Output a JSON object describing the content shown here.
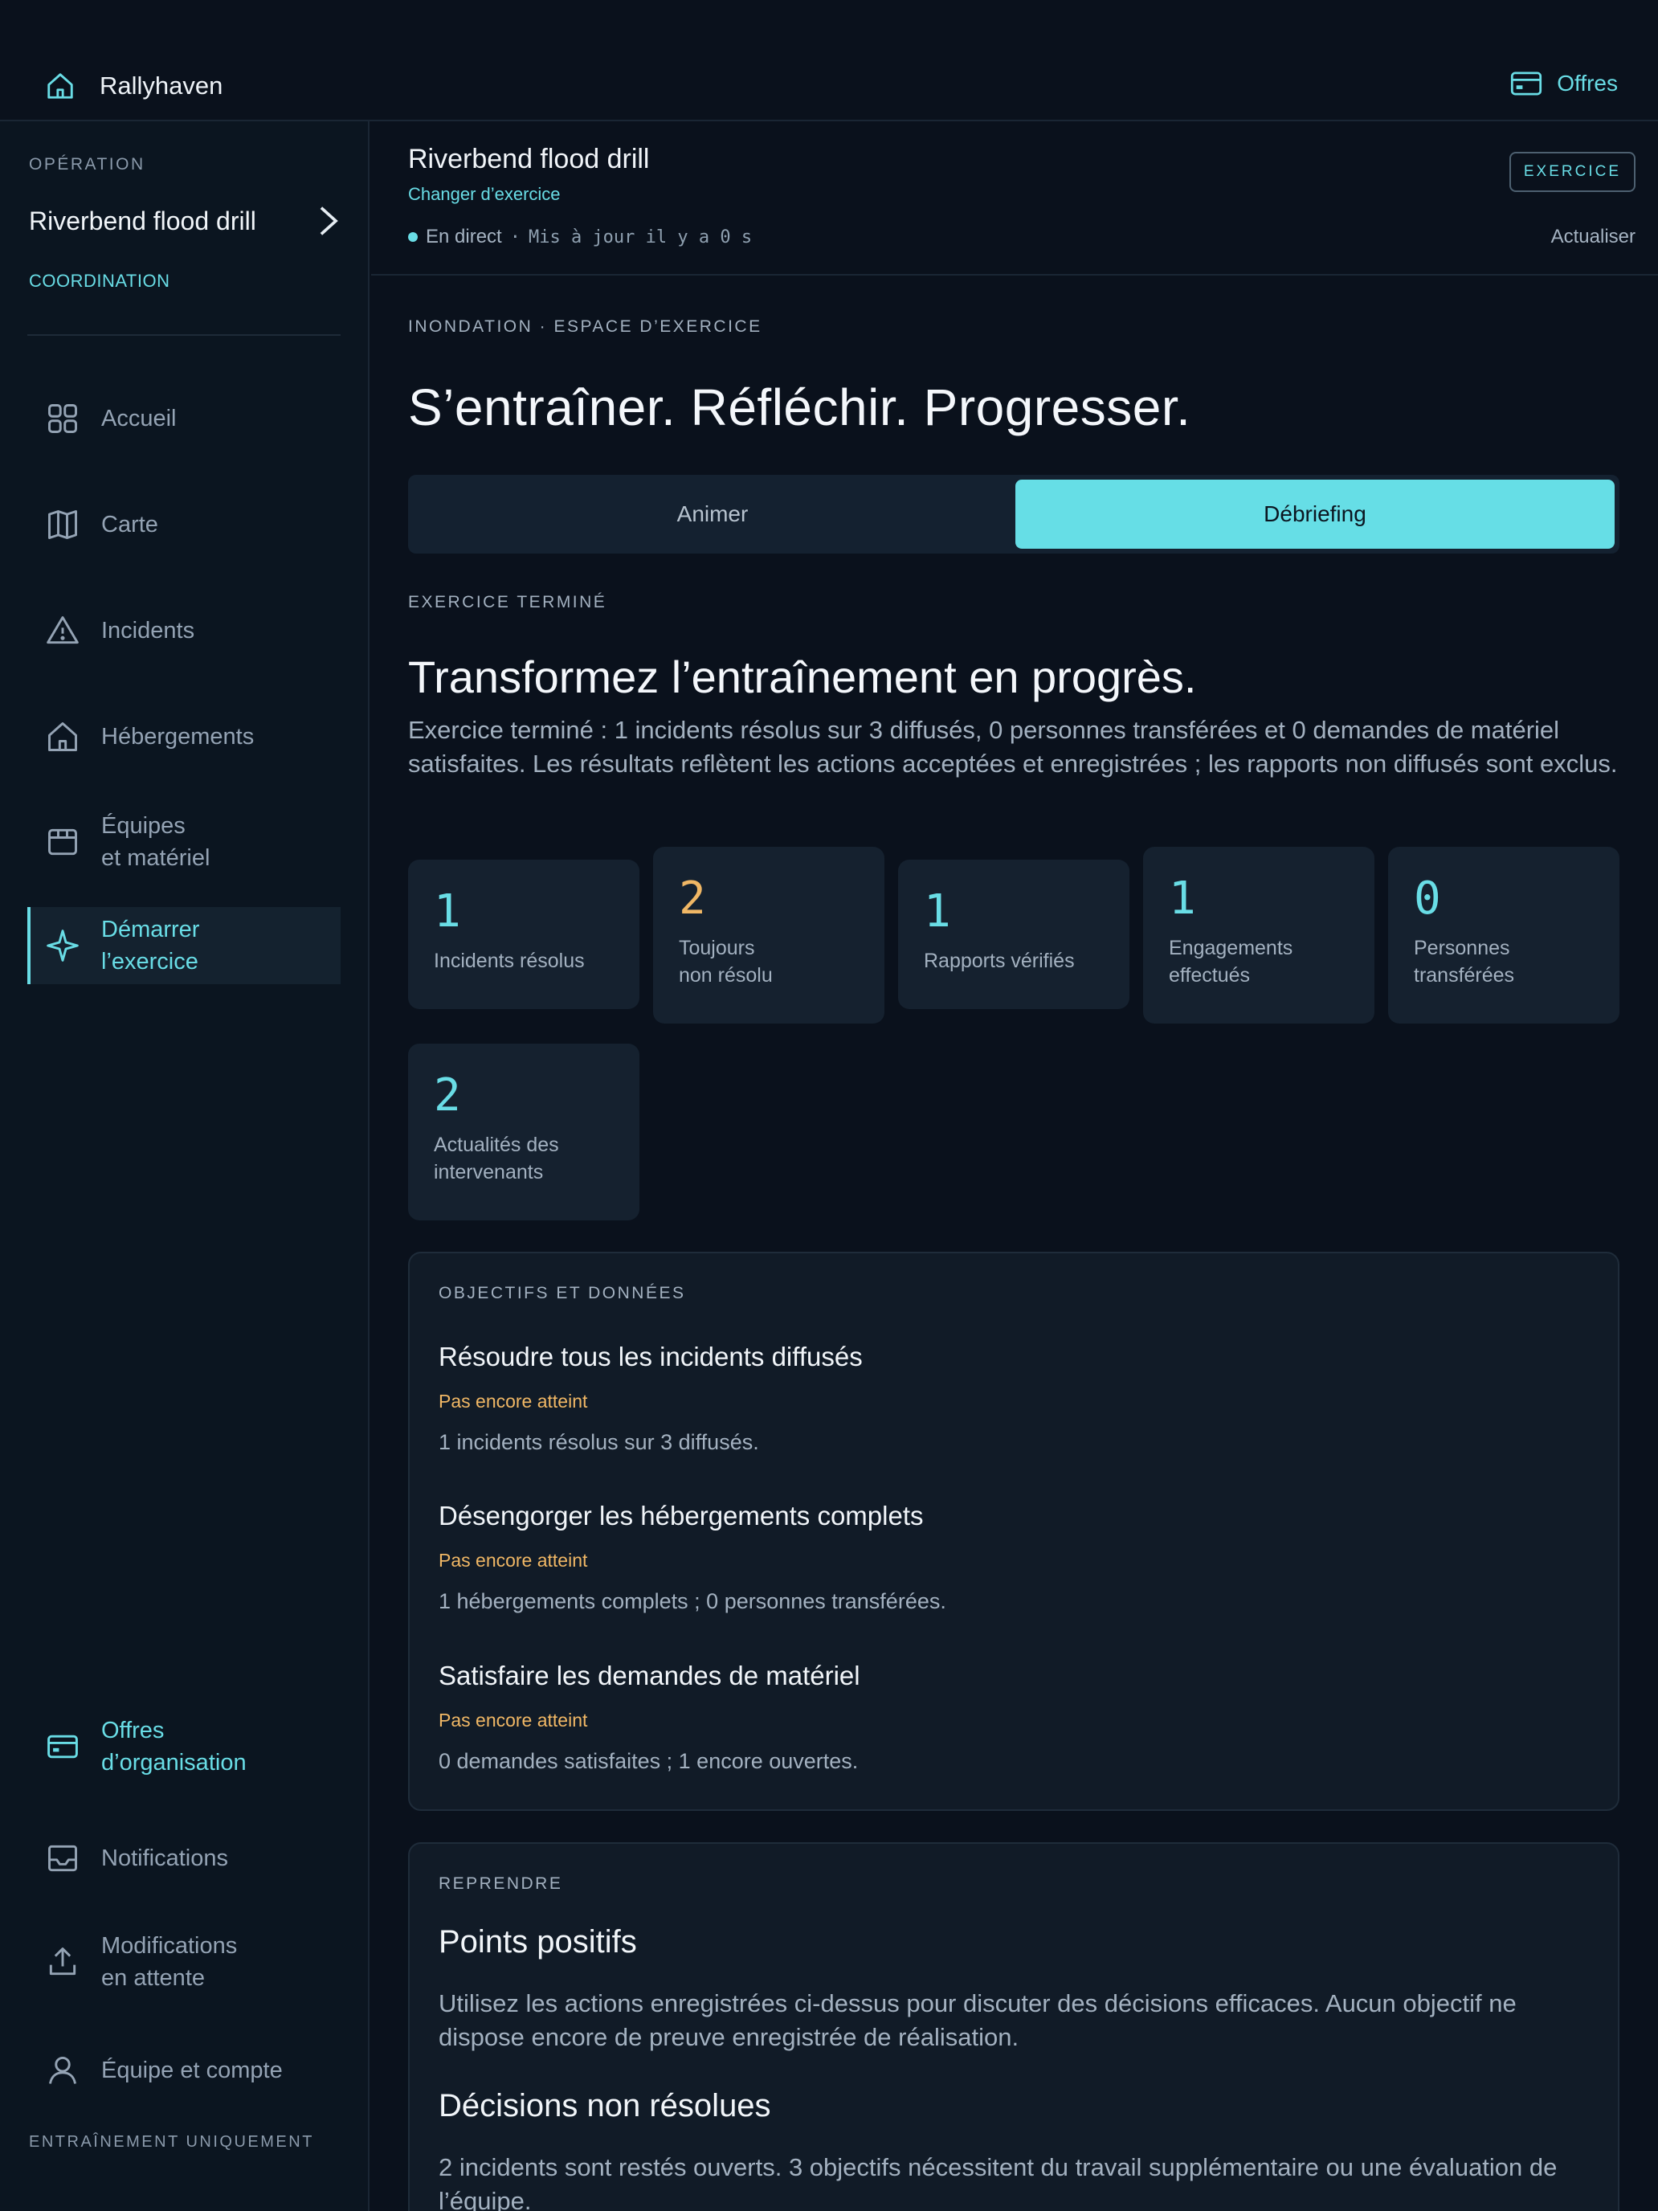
{
  "topbar": {
    "brand": "Rallyhaven",
    "offers": "Offres",
    "icons": {
      "brand": "home-icon",
      "offers": "credit-card-icon"
    }
  },
  "sidebar": {
    "operation_label": "OPÉRATION",
    "operation_name": "Riverbend flood drill",
    "role": "COORDINATION",
    "nav": [
      {
        "label": "Accueil",
        "icon": "grid-icon"
      },
      {
        "label": "Carte",
        "icon": "map-icon"
      },
      {
        "label": "Incidents",
        "icon": "warning-icon"
      },
      {
        "label": "Hébergements",
        "icon": "home-icon"
      },
      {
        "label_1": "Équipes",
        "label_2": "et matériel",
        "icon": "box-icon"
      },
      {
        "label_1": "Démarrer",
        "label_2": "l’exercice",
        "icon": "sparkle-icon",
        "active": true
      }
    ],
    "bottom_nav": [
      {
        "label_1": "Offres",
        "label_2": "d’organisation",
        "icon": "credit-card-icon"
      },
      {
        "label": "Notifications",
        "icon": "inbox-icon"
      },
      {
        "label_1": "Modifications",
        "label_2": "en attente",
        "icon": "upload-icon"
      },
      {
        "label": "Équipe et compte",
        "icon": "user-icon"
      }
    ],
    "footer": "ENTRAÎNEMENT UNIQUEMENT"
  },
  "header": {
    "title": "Riverbend flood drill",
    "change_link": "Changer d’exercice",
    "live": "En direct",
    "separator": "·",
    "updated": "Mis à jour il y a 0 s",
    "badge": "EXERCICE",
    "refresh": "Actualiser"
  },
  "main": {
    "eyebrow": "INONDATION · ESPACE D’EXERCICE",
    "hero": "S’entraîner. Réfléchir. Progresser.",
    "tabs": {
      "left": "Animer",
      "right": "Débriefing",
      "selected": "Débriefing"
    },
    "section_eyebrow": "EXERCICE TERMINÉ",
    "section_title": "Transformez l’entraînement en progrès.",
    "summary": "Exercice terminé : 1 incidents résolus sur 3 diffusés, 0 personnes transférées et 0 demandes de matériel satisfaites. Les résultats reflètent les actions acceptées et enregistrées ; les rapports non diffusés sont exclus.",
    "stats": [
      {
        "value": "1",
        "label_1": "Incidents résolus",
        "label_2": ""
      },
      {
        "value": "2",
        "label_1": "Toujours",
        "label_2": "non résolu"
      },
      {
        "value": "1",
        "label_1": "Rapports vérifiés",
        "label_2": ""
      },
      {
        "value": "1",
        "label_1": "Engagements",
        "label_2": "effectués"
      },
      {
        "value": "0",
        "label_1": "Personnes",
        "label_2": "transférées"
      },
      {
        "value": "2",
        "label_1": "Actualités des",
        "label_2": "intervenants"
      }
    ],
    "colors": {
      "accent": "#69dde6",
      "warning": "#f0b765"
    }
  },
  "objectives": {
    "eyebrow": "OBJECTIFS ET DONNÉES",
    "items": [
      {
        "title": "Résoudre tous les incidents diffusés",
        "status": "Pas encore atteint",
        "desc": "1 incidents résolus sur 3 diffusés."
      },
      {
        "title": "Désengorger les hébergements complets",
        "status": "Pas encore atteint",
        "desc": "1 hébergements complets ; 0 personnes transférées."
      },
      {
        "title": "Satisfaire les demandes de matériel",
        "status": "Pas encore atteint",
        "desc": "0 demandes satisfaites ; 1 encore ouvertes."
      }
    ]
  },
  "review": {
    "eyebrow": "REPRENDRE",
    "positives_title": "Points positifs",
    "positives_text": "Utilisez les actions enregistrées ci-dessus pour discuter des décisions efficaces. Aucun objectif ne dispose encore de preuve enregistrée de réalisation.",
    "unresolved_title": "Décisions non résolues",
    "unresolved_text": "2 incidents sont restés ouverts. 3 objectifs nécessitent du travail supplémentaire ou une évaluation de l’équipe."
  }
}
